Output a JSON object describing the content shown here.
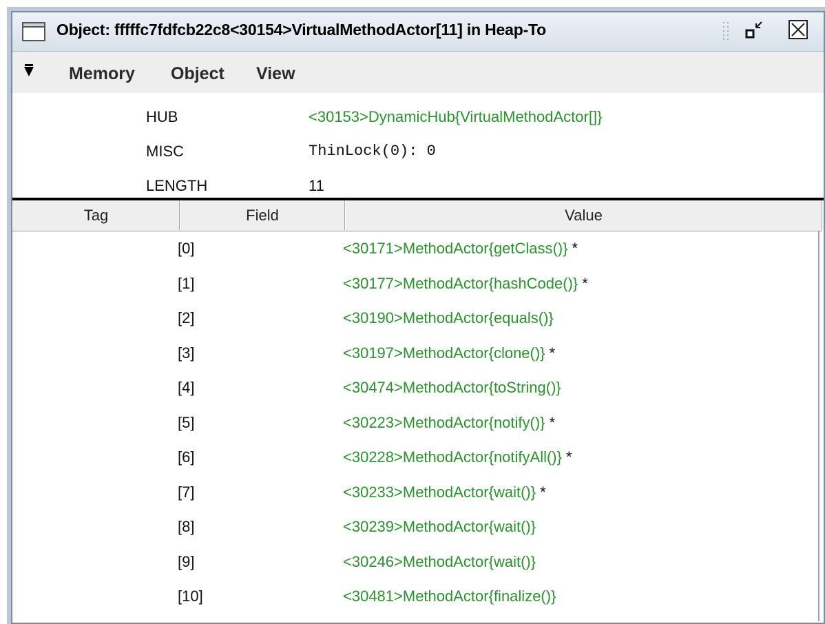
{
  "window": {
    "title": "Object: fffffc7fdfcb22c8<30154>VirtualMethodActor[11] in Heap-To"
  },
  "menubar": {
    "arrow_icon": "down-triangle-icon",
    "items": [
      "Memory",
      "Object",
      "View"
    ]
  },
  "header_fields": {
    "hub": {
      "label": "HUB",
      "value": "<30153>DynamicHub{VirtualMethodActor[]}"
    },
    "misc": {
      "label": "MISC",
      "value": "ThinLock(0): 0"
    },
    "length": {
      "label": "LENGTH",
      "value": "11"
    }
  },
  "table": {
    "columns": [
      "Tag",
      "Field",
      "Value"
    ],
    "rows": [
      {
        "field": "[0]",
        "value": "<30171>MethodActor{getClass()}",
        "marker": "*"
      },
      {
        "field": "[1]",
        "value": "<30177>MethodActor{hashCode()}",
        "marker": "*"
      },
      {
        "field": "[2]",
        "value": "<30190>MethodActor{equals()}",
        "marker": ""
      },
      {
        "field": "[3]",
        "value": "<30197>MethodActor{clone()}",
        "marker": "*"
      },
      {
        "field": "[4]",
        "value": "<30474>MethodActor{toString()}",
        "marker": ""
      },
      {
        "field": "[5]",
        "value": "<30223>MethodActor{notify()}",
        "marker": "*"
      },
      {
        "field": "[6]",
        "value": "<30228>MethodActor{notifyAll()}",
        "marker": "*"
      },
      {
        "field": "[7]",
        "value": "<30233>MethodActor{wait()}",
        "marker": "*"
      },
      {
        "field": "[8]",
        "value": "<30239>MethodActor{wait()}",
        "marker": ""
      },
      {
        "field": "[9]",
        "value": "<30246>MethodActor{wait()}",
        "marker": ""
      },
      {
        "field": "[10]",
        "value": "<30481>MethodActor{finalize()}",
        "marker": ""
      }
    ]
  },
  "colors": {
    "link_green": "#27952a",
    "menubar_bg": "#eeeeee",
    "titlebar_bg": "#d8e0ea"
  }
}
